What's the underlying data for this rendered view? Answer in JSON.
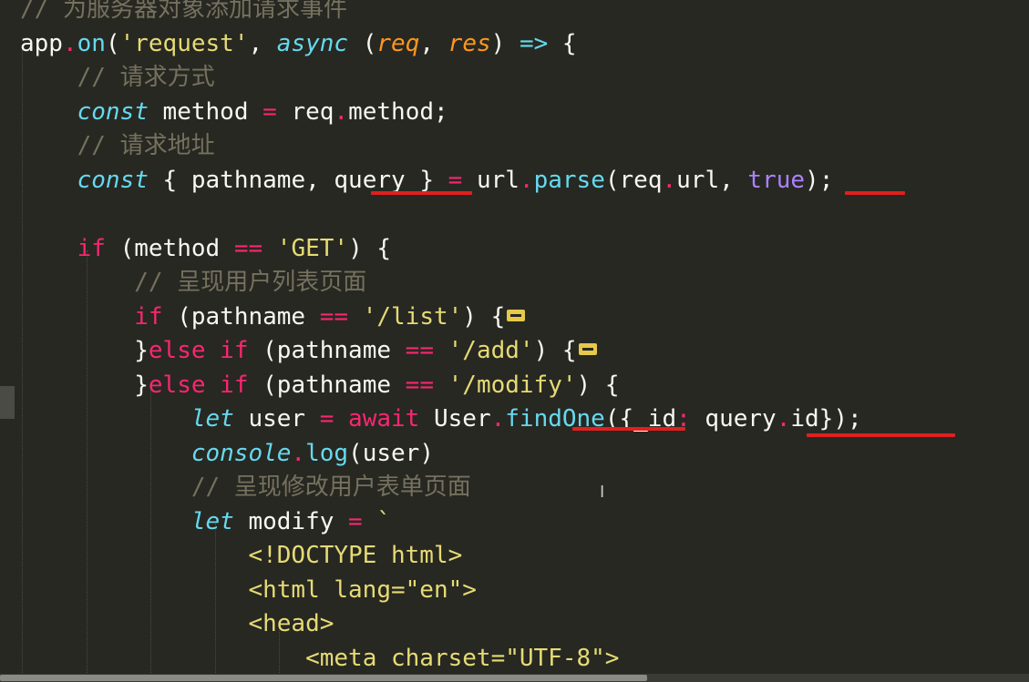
{
  "code": {
    "lines": [
      [
        {
          "t": "// 为服务器对象添加请求事件",
          "c": "comment"
        }
      ],
      [
        {
          "t": "app",
          "c": "ident"
        },
        {
          "t": ".",
          "c": "dot"
        },
        {
          "t": "on",
          "c": "func"
        },
        {
          "t": "(",
          "c": "punct"
        },
        {
          "t": "'request'",
          "c": "str"
        },
        {
          "t": ", ",
          "c": "punct"
        },
        {
          "t": "async",
          "c": "storage"
        },
        {
          "t": " (",
          "c": "punct"
        },
        {
          "t": "req",
          "c": "param"
        },
        {
          "t": ", ",
          "c": "punct"
        },
        {
          "t": "res",
          "c": "param"
        },
        {
          "t": ") ",
          "c": "punct"
        },
        {
          "t": "=>",
          "c": "storage"
        },
        {
          "t": " {",
          "c": "punct"
        }
      ],
      [
        {
          "t": "    "
        },
        {
          "t": "// 请求方式",
          "c": "comment"
        }
      ],
      [
        {
          "t": "    "
        },
        {
          "t": "const",
          "c": "storage"
        },
        {
          "t": " method ",
          "c": "ident"
        },
        {
          "t": "=",
          "c": "op"
        },
        {
          "t": " req",
          "c": "ident"
        },
        {
          "t": ".",
          "c": "dot"
        },
        {
          "t": "method;",
          "c": "ident"
        }
      ],
      [
        {
          "t": "    "
        },
        {
          "t": "// 请求地址",
          "c": "comment"
        }
      ],
      [
        {
          "t": "    "
        },
        {
          "t": "const",
          "c": "storage"
        },
        {
          "t": " { pathname, query } ",
          "c": "ident"
        },
        {
          "t": "=",
          "c": "op"
        },
        {
          "t": " url",
          "c": "ident"
        },
        {
          "t": ".",
          "c": "dot"
        },
        {
          "t": "parse",
          "c": "func"
        },
        {
          "t": "(req",
          "c": "ident"
        },
        {
          "t": ".",
          "c": "dot"
        },
        {
          "t": "url, ",
          "c": "ident"
        },
        {
          "t": "true",
          "c": "const"
        },
        {
          "t": ");",
          "c": "punct"
        }
      ],
      [],
      [
        {
          "t": "    "
        },
        {
          "t": "if",
          "c": "kw"
        },
        {
          "t": " (method ",
          "c": "ident"
        },
        {
          "t": "==",
          "c": "op"
        },
        {
          "t": " ",
          "c": "punct"
        },
        {
          "t": "'GET'",
          "c": "str"
        },
        {
          "t": ") {",
          "c": "punct"
        }
      ],
      [
        {
          "t": "        "
        },
        {
          "t": "// 呈现用户列表页面",
          "c": "comment"
        }
      ],
      [
        {
          "t": "        "
        },
        {
          "t": "if",
          "c": "kw"
        },
        {
          "t": " (pathname ",
          "c": "ident"
        },
        {
          "t": "==",
          "c": "op"
        },
        {
          "t": " ",
          "c": "punct"
        },
        {
          "t": "'/list'",
          "c": "str"
        },
        {
          "t": ") {",
          "c": "punct"
        },
        {
          "fold": true
        }
      ],
      [
        {
          "t": "        "
        },
        {
          "t": "}",
          "c": "punct"
        },
        {
          "t": "else",
          "c": "kw"
        },
        {
          "t": " ",
          "c": "punct"
        },
        {
          "t": "if",
          "c": "kw"
        },
        {
          "t": " (pathname ",
          "c": "ident"
        },
        {
          "t": "==",
          "c": "op"
        },
        {
          "t": " ",
          "c": "punct"
        },
        {
          "t": "'/add'",
          "c": "str"
        },
        {
          "t": ") {",
          "c": "punct"
        },
        {
          "fold": true
        }
      ],
      [
        {
          "t": "        "
        },
        {
          "t": "}",
          "c": "punct"
        },
        {
          "t": "else",
          "c": "kw"
        },
        {
          "t": " ",
          "c": "punct"
        },
        {
          "t": "if",
          "c": "kw"
        },
        {
          "t": " (pathname ",
          "c": "ident"
        },
        {
          "t": "==",
          "c": "op"
        },
        {
          "t": " ",
          "c": "punct"
        },
        {
          "t": "'/modify'",
          "c": "str"
        },
        {
          "t": ") {",
          "c": "punct"
        }
      ],
      [
        {
          "t": "            "
        },
        {
          "t": "let",
          "c": "storage"
        },
        {
          "t": " user ",
          "c": "ident"
        },
        {
          "t": "=",
          "c": "op"
        },
        {
          "t": " ",
          "c": "punct"
        },
        {
          "t": "await",
          "c": "kw"
        },
        {
          "t": " User",
          "c": "ident"
        },
        {
          "t": ".",
          "c": "dot"
        },
        {
          "t": "findOne",
          "c": "func"
        },
        {
          "t": "({_id",
          "c": "ident"
        },
        {
          "t": ":",
          "c": "op"
        },
        {
          "t": " query",
          "c": "ident"
        },
        {
          "t": ".",
          "c": "dot"
        },
        {
          "t": "id});",
          "c": "ident"
        }
      ],
      [
        {
          "t": "            "
        },
        {
          "t": "console",
          "c": "storage"
        },
        {
          "t": ".",
          "c": "dot"
        },
        {
          "t": "log",
          "c": "func"
        },
        {
          "t": "(user)",
          "c": "ident"
        }
      ],
      [
        {
          "t": "            "
        },
        {
          "t": "// 呈现修改用户表单页面",
          "c": "comment"
        }
      ],
      [
        {
          "t": "            "
        },
        {
          "t": "let",
          "c": "storage"
        },
        {
          "t": " modify ",
          "c": "ident"
        },
        {
          "t": "=",
          "c": "op"
        },
        {
          "t": " `",
          "c": "str"
        }
      ],
      [
        {
          "t": "                "
        },
        {
          "t": "<!DOCTYPE html>",
          "c": "str"
        }
      ],
      [
        {
          "t": "                "
        },
        {
          "t": "<html lang=\"en\">",
          "c": "str"
        }
      ],
      [
        {
          "t": "                "
        },
        {
          "t": "<head>",
          "c": "str"
        }
      ],
      [
        {
          "t": "                    "
        },
        {
          "t": "<meta charset=\"UTF-8\">",
          "c": "str"
        }
      ]
    ]
  },
  "cursor": {
    "glyph": "I"
  }
}
